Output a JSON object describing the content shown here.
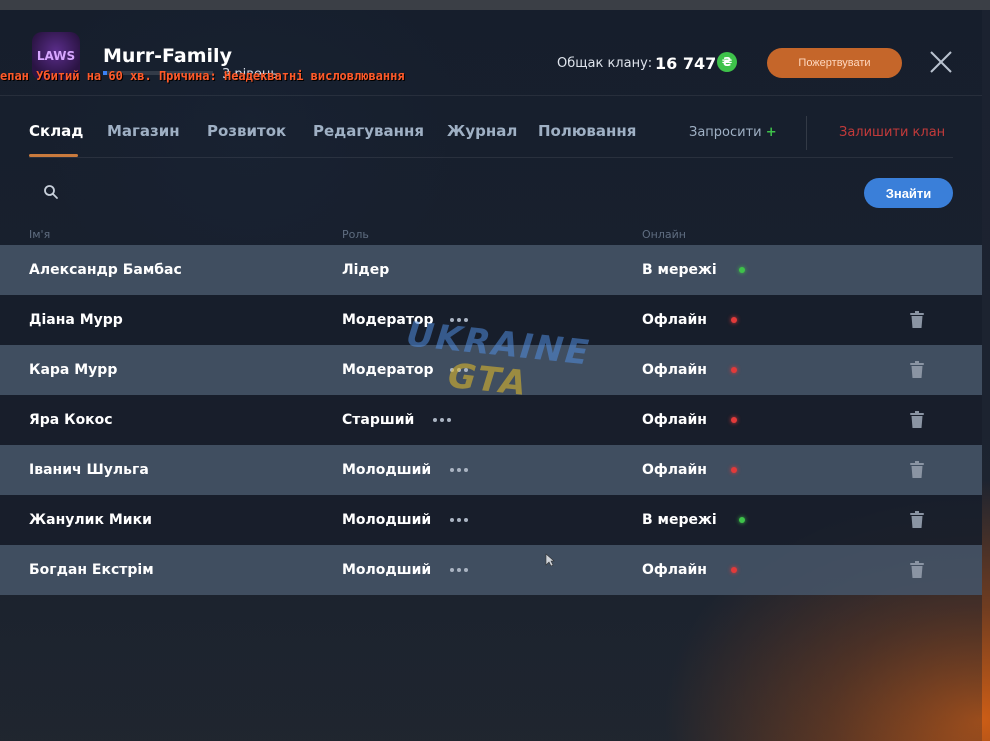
{
  "header": {
    "clan_name": "Murr-Family",
    "level_text": "3 рівень",
    "level_progress": 0.04,
    "ban_message": "епан Убитий на 60 хв. Причина: Неадекватні висловлювання",
    "balance_label": "Общак клану:",
    "balance_value": "16 747",
    "coin_symbol": "₴",
    "donate_label": "Пожертвувати",
    "logo_text": "LAWS"
  },
  "tabs": [
    {
      "label": "Склад",
      "active": true
    },
    {
      "label": "Магазин",
      "active": false
    },
    {
      "label": "Розвиток",
      "active": false
    },
    {
      "label": "Редагування",
      "active": false
    },
    {
      "label": "Журнал",
      "active": false
    },
    {
      "label": "Полювання",
      "active": false
    }
  ],
  "actions": {
    "invite_label": "Запросити",
    "invite_plus": "+",
    "leave_label": "Залишити клан"
  },
  "search": {
    "placeholder": "",
    "value": "",
    "button_label": "Знайти"
  },
  "table": {
    "headers": {
      "name": "Ім'я",
      "role": "Роль",
      "online": "Онлайн"
    },
    "rows": [
      {
        "name": "Александр Бамбас",
        "role": "Лідер",
        "status": "В мережі",
        "online": true,
        "has_menu": false,
        "deletable": false
      },
      {
        "name": "Діана Мурр",
        "role": "Модератор",
        "status": "Офлайн",
        "online": false,
        "has_menu": true,
        "deletable": true
      },
      {
        "name": "Кара Мурр",
        "role": "Модератор",
        "status": "Офлайн",
        "online": false,
        "has_menu": true,
        "deletable": true
      },
      {
        "name": "Яра Кокос",
        "role": "Старший",
        "status": "Офлайн",
        "online": false,
        "has_menu": true,
        "deletable": true
      },
      {
        "name": "Іванич Шульга",
        "role": "Молодший",
        "status": "Офлайн",
        "online": false,
        "has_menu": true,
        "deletable": true
      },
      {
        "name": "Жанулик Мики",
        "role": "Молодший",
        "status": "В мережі",
        "online": true,
        "has_menu": true,
        "deletable": true
      },
      {
        "name": "Богдан Екстрім",
        "role": "Молодший",
        "status": "Офлайн",
        "online": false,
        "has_menu": true,
        "deletable": true
      }
    ]
  },
  "watermark": {
    "line1": "UKRAINE",
    "line2": "GTA"
  },
  "colors": {
    "accent": "#c97a3d",
    "online": "#3ec24a",
    "offline": "#e23a3a",
    "primary_button": "#3a7fd9",
    "donate_button": "#c5662a"
  }
}
